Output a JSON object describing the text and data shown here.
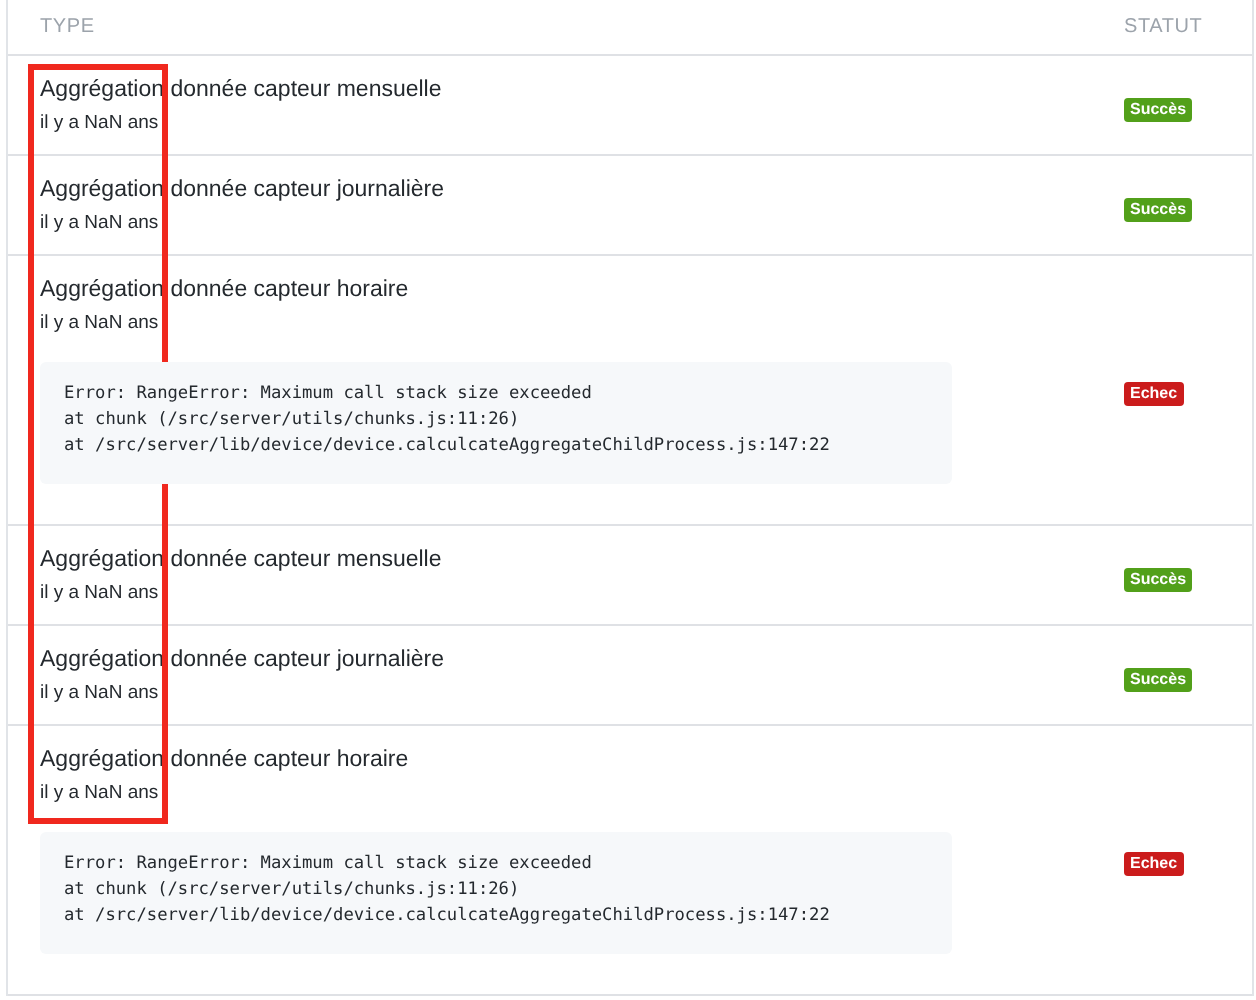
{
  "columns": [
    "TYPE",
    "STATUT"
  ],
  "rows": [
    {
      "title": "Aggrégation donnée capteur mensuelle",
      "time": "il y a NaN ans",
      "status": {
        "kind": "success",
        "label": "Succès"
      }
    },
    {
      "title": "Aggrégation donnée capteur journalière",
      "time": "il y a NaN ans",
      "status": {
        "kind": "success",
        "label": "Succès"
      }
    },
    {
      "title": "Aggrégation donnée capteur horaire",
      "time": "il y a NaN ans",
      "error": [
        "Error: RangeError: Maximum call stack size exceeded",
        "at chunk (/src/server/utils/chunks.js:11:26)",
        "at /src/server/lib/device/device.calculcateAggregateChildProcess.js:147:22"
      ],
      "status": {
        "kind": "failure",
        "label": "Echec"
      }
    },
    {
      "title": "Aggrégation donnée capteur mensuelle",
      "time": "il y a NaN ans",
      "status": {
        "kind": "success",
        "label": "Succès"
      }
    },
    {
      "title": "Aggrégation donnée capteur journalière",
      "time": "il y a NaN ans",
      "status": {
        "kind": "success",
        "label": "Succès"
      }
    },
    {
      "title": "Aggrégation donnée capteur horaire",
      "time": "il y a NaN ans",
      "error": [
        "Error: RangeError: Maximum call stack size exceeded",
        "at chunk (/src/server/utils/chunks.js:11:26)",
        "at /src/server/lib/device/device.calculcateAggregateChildProcess.js:147:22"
      ],
      "status": {
        "kind": "failure",
        "label": "Echec"
      }
    }
  ]
}
